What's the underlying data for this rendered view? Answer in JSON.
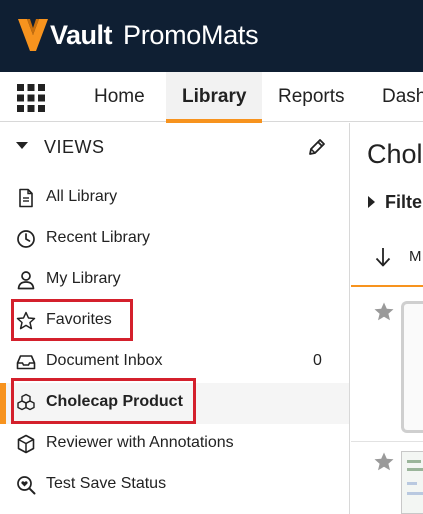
{
  "brand": {
    "vault": "Vault",
    "app_name": "PromoMats",
    "logo_icon": "vault-v-logo-icon",
    "bg_color": "#0f1f33",
    "logo_color": "#f7931e"
  },
  "nav": {
    "apps_icon": "apps-grid-icon",
    "tabs": [
      {
        "label": "Home",
        "active": false
      },
      {
        "label": "Library",
        "active": true
      },
      {
        "label": "Reports",
        "active": false
      },
      {
        "label": "Dash",
        "active": false
      }
    ],
    "accent_color": "#f7931e"
  },
  "sidebar": {
    "views_label": "VIEWS",
    "edit_icon": "pencil-icon",
    "items": [
      {
        "label": "All Library",
        "icon": "document-icon",
        "count": ""
      },
      {
        "label": "Recent Library",
        "icon": "clock-icon",
        "count": ""
      },
      {
        "label": "My Library",
        "icon": "user-icon",
        "count": ""
      },
      {
        "label": "Favorites",
        "icon": "star-icon",
        "count": "",
        "highlighted": true
      },
      {
        "label": "Document Inbox",
        "icon": "inbox-icon",
        "count": "0"
      },
      {
        "label": "Cholecap Product",
        "icon": "cubes-icon",
        "count": "",
        "selected": true,
        "highlighted": true
      },
      {
        "label": "Reviewer with Annotations",
        "icon": "cube-icon",
        "count": ""
      },
      {
        "label": "Test Save Status",
        "icon": "search-heart-icon",
        "count": ""
      }
    ],
    "highlight_color": "#d4202c"
  },
  "main": {
    "title": "Chole",
    "filter_label": "Filte",
    "sort_icon": "arrow-down-icon",
    "sort_label": "M",
    "row_star_icon": "star-filled-icon"
  }
}
